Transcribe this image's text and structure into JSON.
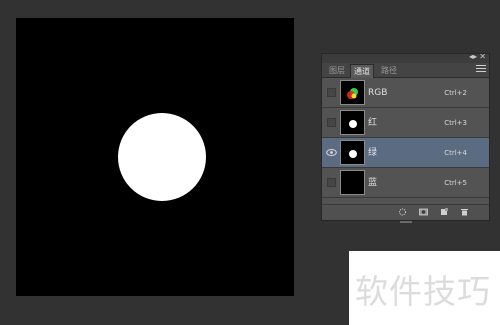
{
  "panel": {
    "collapse_glyph": "◂▸",
    "close_glyph": "✕",
    "tabs": [
      {
        "label": "图层",
        "active": false
      },
      {
        "label": "通道",
        "active": true
      },
      {
        "label": "路径",
        "active": false
      }
    ],
    "channels": [
      {
        "name": "RGB",
        "shortcut": "Ctrl+2",
        "visible": false,
        "selected": false,
        "thumb": "rgb"
      },
      {
        "name": "红",
        "shortcut": "Ctrl+3",
        "visible": false,
        "selected": false,
        "thumb": "mask"
      },
      {
        "name": "绿",
        "shortcut": "Ctrl+4",
        "visible": true,
        "selected": true,
        "thumb": "mask"
      },
      {
        "name": "蓝",
        "shortcut": "Ctrl+5",
        "visible": false,
        "selected": false,
        "thumb": "black"
      }
    ],
    "footer_icons": [
      "load-selection-icon",
      "save-selection-icon",
      "new-channel-icon",
      "delete-icon"
    ]
  },
  "watermark": {
    "text": "软件技巧"
  },
  "colors": {
    "workspace": "#323232",
    "panel": "#535353",
    "selected_row": "#5b6b82",
    "canvas": "#000000",
    "shape": "#ffffff"
  }
}
